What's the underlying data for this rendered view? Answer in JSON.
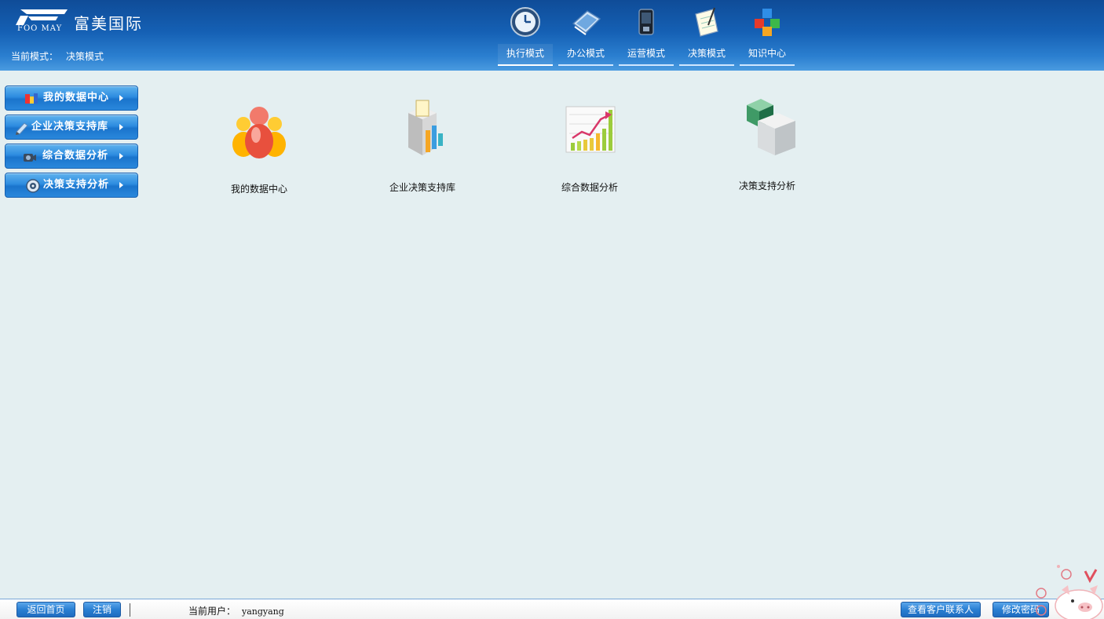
{
  "header": {
    "logo_text": "富美国际",
    "logo_sub": "FOO MAY",
    "mode_label": "当前模式：",
    "mode_value": "决策模式",
    "nav": [
      {
        "label": "执行模式",
        "icon": "clock-icon",
        "active": true
      },
      {
        "label": "办公模式",
        "icon": "notebook-icon"
      },
      {
        "label": "运营模式",
        "icon": "phone-icon"
      },
      {
        "label": "决策模式",
        "icon": "notepad-pen-icon"
      },
      {
        "label": "知识中心",
        "icon": "cubes-icon"
      }
    ]
  },
  "sidebar": {
    "items": [
      {
        "label": "我的数据中心",
        "icon": "data-blocks-icon"
      },
      {
        "label": "企业决策支持库",
        "icon": "pencil-icon"
      },
      {
        "label": "综合数据分析",
        "icon": "camera-icon"
      },
      {
        "label": "决策支持分析",
        "icon": "disc-icon"
      }
    ]
  },
  "main": {
    "tiles": [
      {
        "label": "我的数据中心",
        "icon": "people-group-icon"
      },
      {
        "label": "企业决策支持库",
        "icon": "box-chart-icon"
      },
      {
        "label": "综合数据分析",
        "icon": "growth-chart-icon"
      },
      {
        "label": "决策支持分析",
        "icon": "glass-cubes-icon"
      }
    ]
  },
  "footer": {
    "home_label": "返回首页",
    "logout_label": "注销",
    "user_label": "当前用户：",
    "user_name": "yangyang",
    "contacts_label": "查看客户联系人",
    "change_pwd_label": "修改密码"
  },
  "colors": {
    "header_top": "#0f4c98",
    "header_bottom": "#4a9be0",
    "page_bg": "#e4eff1",
    "button_blue": "#2a88dc"
  }
}
